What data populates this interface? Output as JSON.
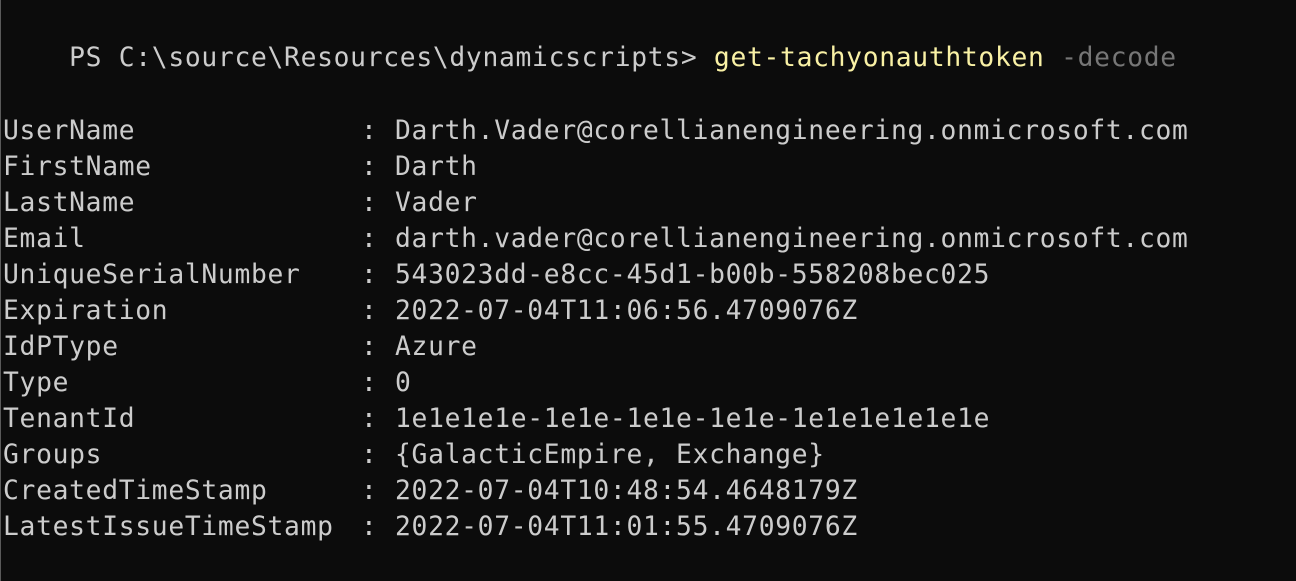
{
  "terminal": {
    "prompt": "PS C:\\source\\Resources\\dynamicscripts> ",
    "command": "get-tachyonauthtoken",
    "parameter": " -decode",
    "separator": ": ",
    "properties": [
      {
        "key": "UserName",
        "value": "Darth.Vader@corellianengineering.onmicrosoft.com"
      },
      {
        "key": "FirstName",
        "value": "Darth"
      },
      {
        "key": "LastName",
        "value": "Vader"
      },
      {
        "key": "Email",
        "value": "darth.vader@corellianengineering.onmicrosoft.com"
      },
      {
        "key": "UniqueSerialNumber",
        "value": "543023dd-e8cc-45d1-b00b-558208bec025"
      },
      {
        "key": "Expiration",
        "value": "2022-07-04T11:06:56.4709076Z"
      },
      {
        "key": "IdPType",
        "value": "Azure"
      },
      {
        "key": "Type",
        "value": "0"
      },
      {
        "key": "TenantId",
        "value": "1e1e1e1e-1e1e-1e1e-1e1e-1e1e1e1e1e1e"
      },
      {
        "key": "Groups",
        "value": "{GalacticEmpire, Exchange}"
      },
      {
        "key": "CreatedTimeStamp",
        "value": "2022-07-04T10:48:54.4648179Z"
      },
      {
        "key": "LatestIssueTimeStamp",
        "value": "2022-07-04T11:01:55.4709076Z"
      }
    ]
  },
  "colors": {
    "background": "#0c0c0c",
    "text": "#cccccc",
    "command": "#f9f1a5",
    "parameter": "#767676"
  }
}
